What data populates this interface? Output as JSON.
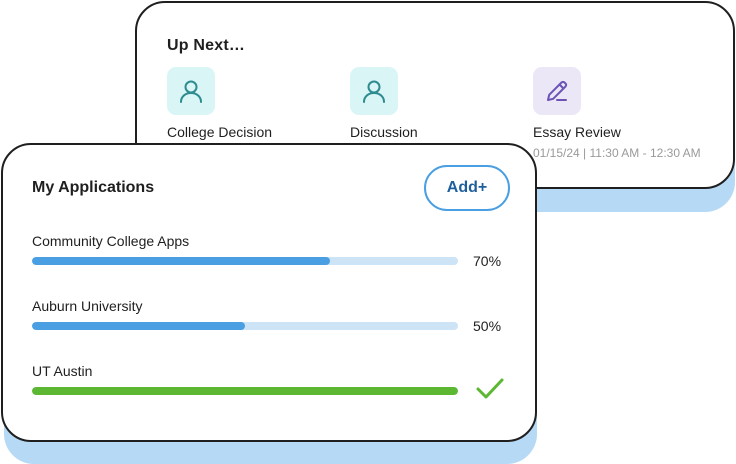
{
  "up_next": {
    "title": "Up Next…",
    "items": [
      {
        "label": "College Decision",
        "icon": "person-icon",
        "meta": ""
      },
      {
        "label": "Discussion",
        "icon": "person-icon",
        "meta": ""
      },
      {
        "label": "Essay Review",
        "icon": "pencil-icon",
        "meta": "01/15/24 | 11:30 AM - 12:30 AM"
      }
    ]
  },
  "applications": {
    "title": "My Applications",
    "add_label": "Add+",
    "items": [
      {
        "name": "Community College Apps",
        "progress": 0.7,
        "progress_label": "70%",
        "complete": false
      },
      {
        "name": "Auburn University",
        "progress": 0.5,
        "progress_label": "50%",
        "complete": false
      },
      {
        "name": "UT Austin",
        "progress": 1.0,
        "progress_label": "",
        "complete": true
      }
    ]
  },
  "colors": {
    "accent_blue": "#4a9fe3",
    "track_blue": "#cde3f6",
    "complete_green": "#5cb832",
    "icon_teal_bg": "#d9f5f6",
    "icon_teal_fg": "#2e8b8f",
    "icon_purple_bg": "#ebe7f6",
    "icon_purple_fg": "#6c54b5",
    "shadow_blue": "#b6d9f5"
  }
}
